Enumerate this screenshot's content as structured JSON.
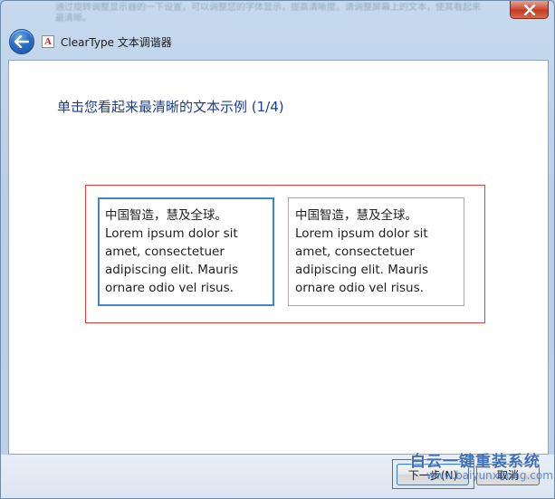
{
  "window": {
    "title": "ClearType 文本调谐器",
    "background_text": "通过旋转调整显示器的一下设置，可以调整您的字体显示，提高清晰度。请调整屏幕上的文本，使其看起来最清晰。",
    "close_label": "关闭"
  },
  "nav": {
    "back_icon": "back-arrow-icon",
    "app_icon": "cleartype-icon",
    "app_icon_glyph": "A"
  },
  "main": {
    "heading": "单击您看起来最清晰的文本示例 (1/4)",
    "samples": [
      {
        "chinese": "中国智造，慧及全球。",
        "latin": "Lorem ipsum dolor sit amet, consectetuer adipiscing elit. Mauris ornare odio vel risus.",
        "selected": true
      },
      {
        "chinese": "中国智造，慧及全球。",
        "latin": "Lorem ipsum dolor sit amet, consectetuer adipiscing elit. Mauris ornare odio vel risus.",
        "selected": false
      }
    ]
  },
  "footer": {
    "next_label": "下一步(N)",
    "cancel_label": "取消"
  },
  "watermark": {
    "title": "白云一键重装系统",
    "url": "www.baiyunxitong.com"
  },
  "colors": {
    "heading": "#1b3d8f",
    "selected_border": "#3c87cf",
    "highlight_frame": "#e13b3b",
    "close_button": "#c23b22"
  }
}
